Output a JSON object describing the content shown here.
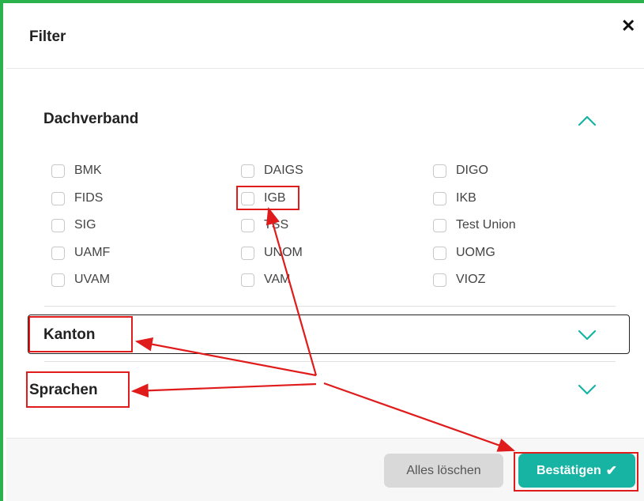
{
  "modal": {
    "title": "Filter",
    "close_icon": "close-icon"
  },
  "sections": {
    "dachverband": {
      "title": "Dachverband",
      "expanded": true,
      "options": [
        "BMK",
        "DAIGS",
        "DIGO",
        "FIDS",
        "IGB",
        "IKB",
        "SIG",
        "TSS",
        "Test Union",
        "UAMF",
        "UNOM",
        "UOMG",
        "UVAM",
        "VAM",
        "VIOZ"
      ]
    },
    "kanton": {
      "title": "Kanton",
      "expanded": false
    },
    "sprachen": {
      "title": "Sprachen",
      "expanded": false
    }
  },
  "footer": {
    "clear_label": "Alles löschen",
    "confirm_label": "Bestätigen",
    "confirm_icon": "checkmark-icon"
  },
  "colors": {
    "accent": "#17b3a3",
    "frame": "#2bb24c",
    "annotation": "#e01b1b"
  }
}
